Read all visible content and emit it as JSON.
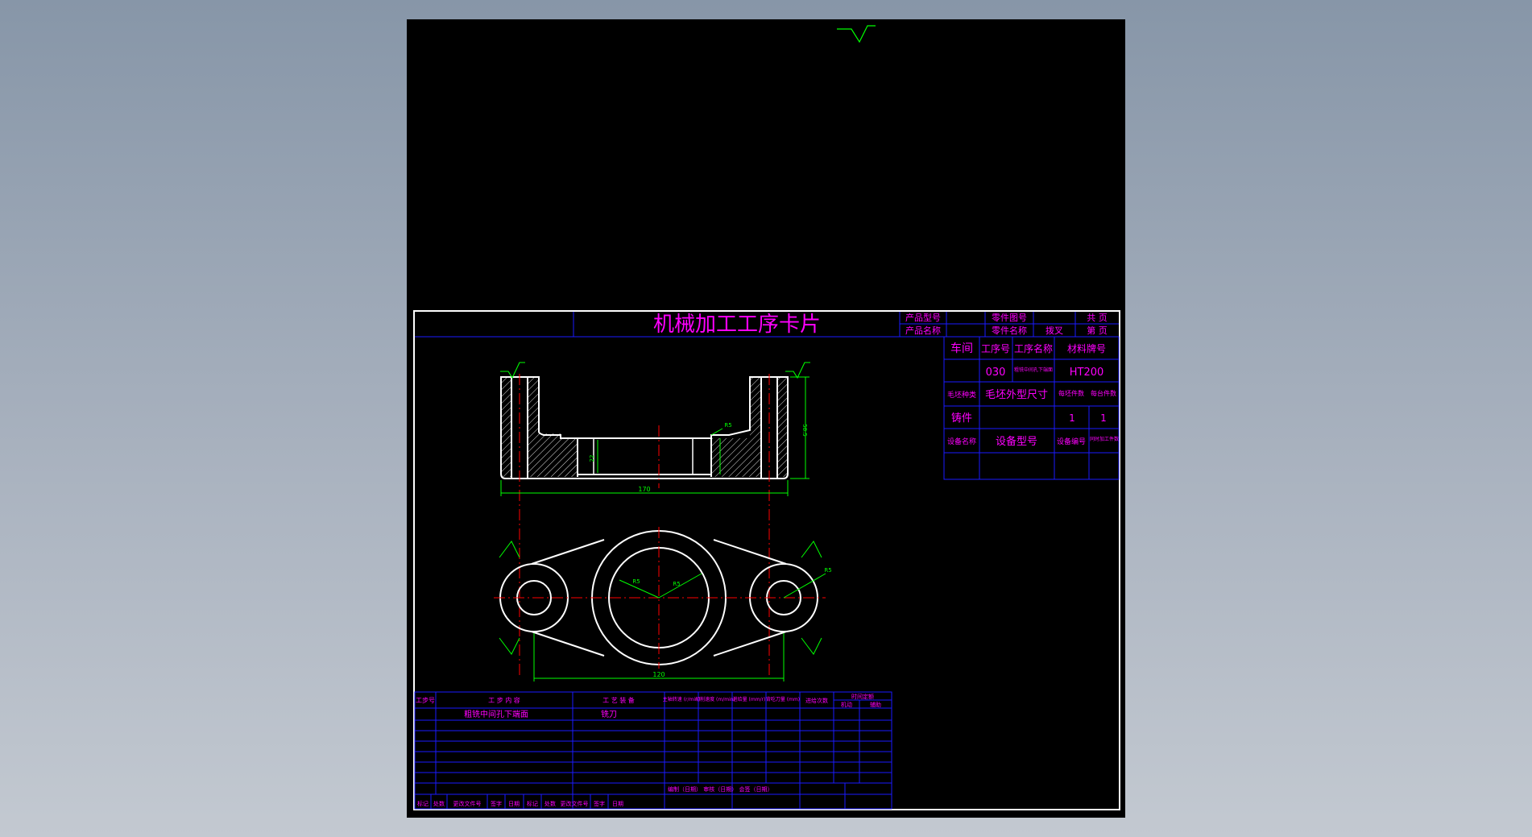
{
  "card": {
    "title": "机械加工工序卡片",
    "product_model_label": "产品型号",
    "product_name_label": "产品名称",
    "part_drawing_no_label": "零件图号",
    "part_name_label": "零件名称",
    "part_name_value": "拨叉",
    "total_pages_label": "共   页",
    "page_no_label": "第   页"
  },
  "info": {
    "workshop_label": "车间",
    "process_no_label": "工序号",
    "process_name_label": "工序名称",
    "material_label": "材料牌号",
    "process_no_value": "030",
    "process_name_value": "粗铣中间孔下端面",
    "material_value": "HT200",
    "blank_type_label": "毛坯种类",
    "blank_size_label": "毛坯外型尺寸",
    "per_blank_label": "每坯件数",
    "per_unit_label": "每台件数",
    "blank_type_value": "铸件",
    "per_blank_value": "1",
    "per_unit_value": "1",
    "equip_name_label": "设备名称",
    "equip_model_label": "设备型号",
    "equip_no_label": "设备编号",
    "simul_label": "同时加工件数"
  },
  "steps": {
    "headers": {
      "step_no": "工步号",
      "content": "工  步  内  容",
      "equipment": "工  艺  装  备",
      "spindle": "主轴转速 (r/min)",
      "cut_speed": "切削速度 (m/min)",
      "feed": "进给量 (mm/r)",
      "depth": "背吃刀量 (mm)",
      "passes": "进给次数",
      "time": "时间定额",
      "time_mach": "机动",
      "time_aux": "辅助"
    },
    "rows": [
      {
        "content": "粗铣中间孔下端面",
        "equipment": "铣刀"
      }
    ]
  },
  "footer": {
    "sign": "编制（日期）  审核（日期）  会签（日期）",
    "mark1": "标记",
    "count1": "处数",
    "change1": "更改文件号",
    "signature1": "签字",
    "date1": "日期",
    "mark2": "标记",
    "count2": "处数",
    "change2": "更改文件号",
    "signature2": "签字",
    "date2": "日期"
  },
  "dims": {
    "length_top": "170",
    "length_bottom": "120",
    "height": "58.5",
    "bore": "22",
    "chamfer": "R5",
    "r1": "R5",
    "r2": "R5",
    "r3": "R5"
  },
  "colors": {
    "magenta": "#ff00ff",
    "blue": "#1a1aff",
    "green": "#00ff00",
    "red": "#ff0000",
    "white": "#ffffff",
    "background": "#000000",
    "outer_gradient_top": "#8796a8",
    "outer_gradient_bottom": "#c3c9d1"
  }
}
